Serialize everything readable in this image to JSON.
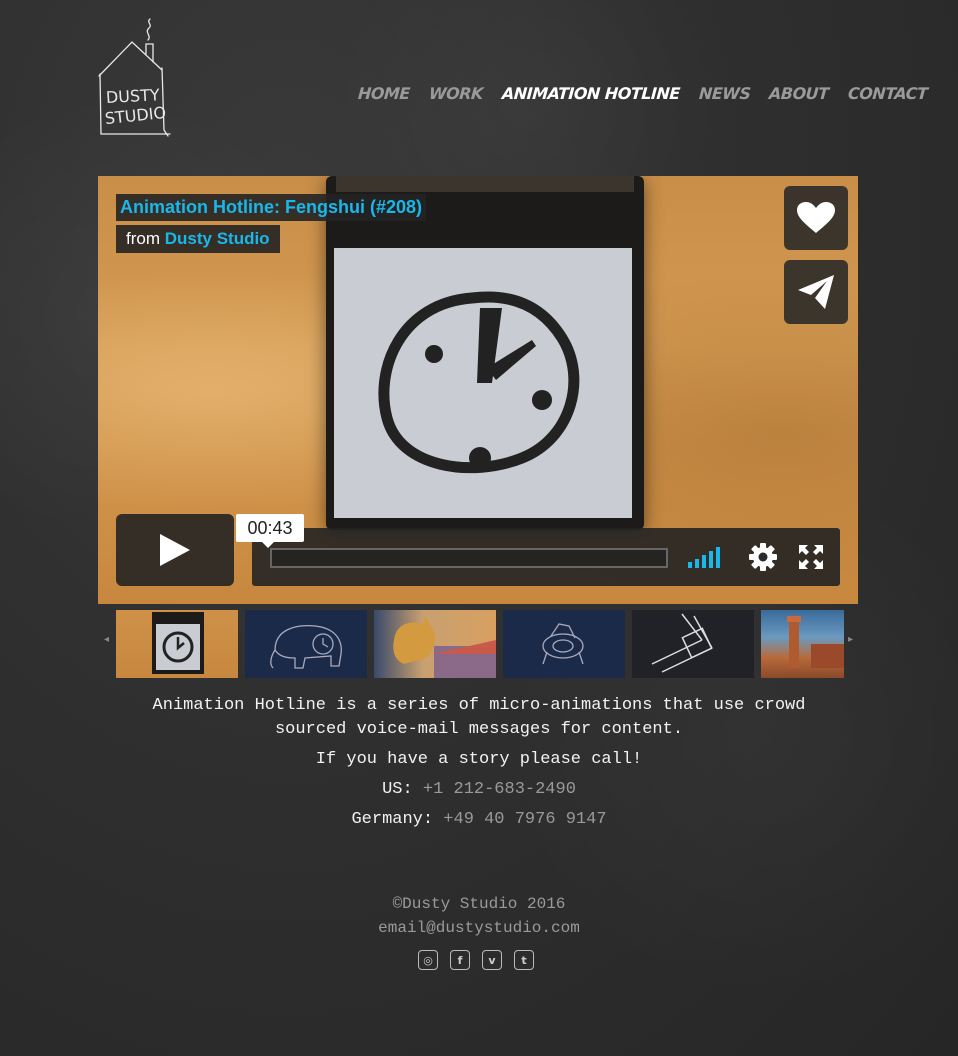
{
  "logo": {
    "line1": "DUSTY",
    "line2": "STUDIO"
  },
  "nav": {
    "home": "HOME",
    "work": "WORK",
    "hotline": "ANIMATION HOTLINE",
    "news": "NEWS",
    "about": "ABOUT",
    "contact": "CONTACT"
  },
  "player": {
    "title": "Animation Hotline: Fengshui (#208)",
    "from_label": "from",
    "from_name": "Dusty Studio",
    "time": "00:43",
    "progress": 0,
    "icons": [
      "heart-icon",
      "send-icon",
      "play-icon",
      "volume-icon",
      "gear-icon",
      "fullscreen-icon"
    ],
    "accent": "#19b7ea"
  },
  "thumbnails": [
    "clock",
    "elephant",
    "cat",
    "watch-chalk",
    "wristwatch",
    "city"
  ],
  "content": {
    "description": "Animation Hotline is a series of micro-animations that use crowd sourced voice-mail messages for content.",
    "call_prompt": "If you have a story please call!",
    "us_label": "US:",
    "us_number": "+1 212-683-2490",
    "de_label": "Germany:",
    "de_number": "+49 40 7976 9147"
  },
  "footer": {
    "copyright": "©Dusty Studio 2016",
    "email": "email@dustystudio.com",
    "socials": [
      "instagram-icon",
      "facebook-icon",
      "vimeo-icon",
      "tumblr-icon"
    ]
  }
}
